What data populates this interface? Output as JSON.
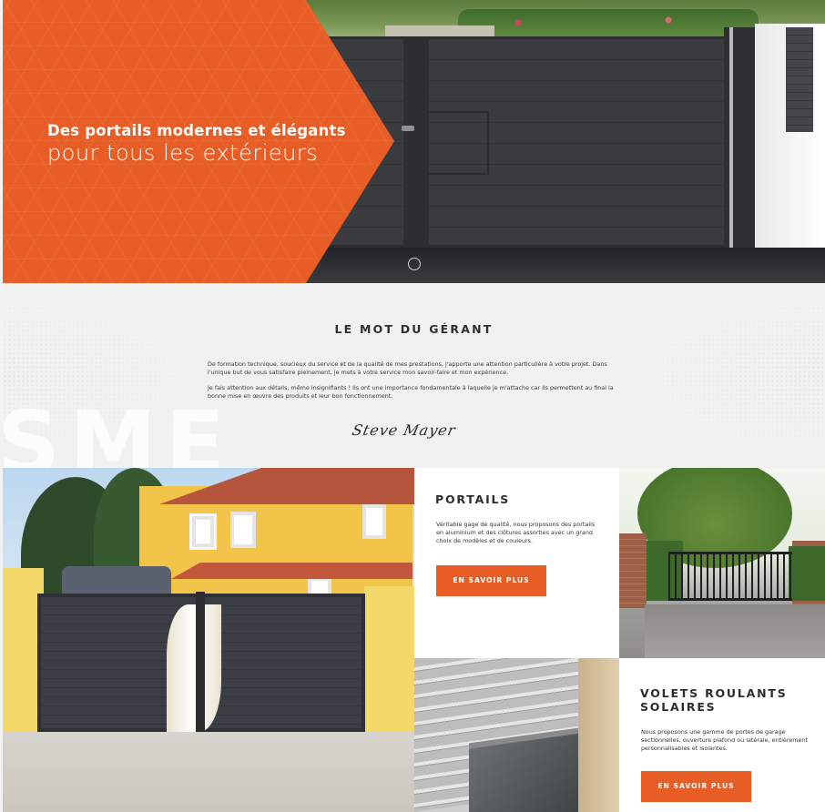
{
  "hero": {
    "title_line1": "Des portails modernes et élégants",
    "title_line2": "pour tous les extérieurs"
  },
  "manager": {
    "title": "LE MOT DU GÉRANT",
    "paragraph1": "De formation technique, soucieux du service et de la qualité de mes prestations, j'apporte une attention particulière à votre projet. Dans l'unique but de vous satisfaire pleinement, je mets à votre service mon savoir-faire et mon expérience.",
    "paragraph2": "Je fais attention aux détails, même insignifiants ! Ils ont une importance fondamentale à laquelle je m'attache car ils permettent au final la bonne mise en œuvre des produits et leur bon fonctionnement.",
    "signature": "Steve Mayer",
    "background_logo": "SME"
  },
  "portails": {
    "title": "PORTAILS",
    "text": "Véritable gage de qualité, nous proposons des portails en aluminium et des clôtures assorties avec un grand choix de modèles et de couleurs.",
    "button_label": "EN SAVOIR PLUS"
  },
  "volets": {
    "title": "VOLETS ROULANTS SOLAIRES",
    "text": "Nous proposons une gamme de portes de garage sectionnelles, ouverture plafond ou latérale, entièrement personnalisables et isolantes.",
    "button_label": "EN SAVOIR PLUS"
  },
  "colors": {
    "accent": "#e85d25",
    "dark_text": "#2d2d2d",
    "section_bg": "#f1f1f1"
  }
}
